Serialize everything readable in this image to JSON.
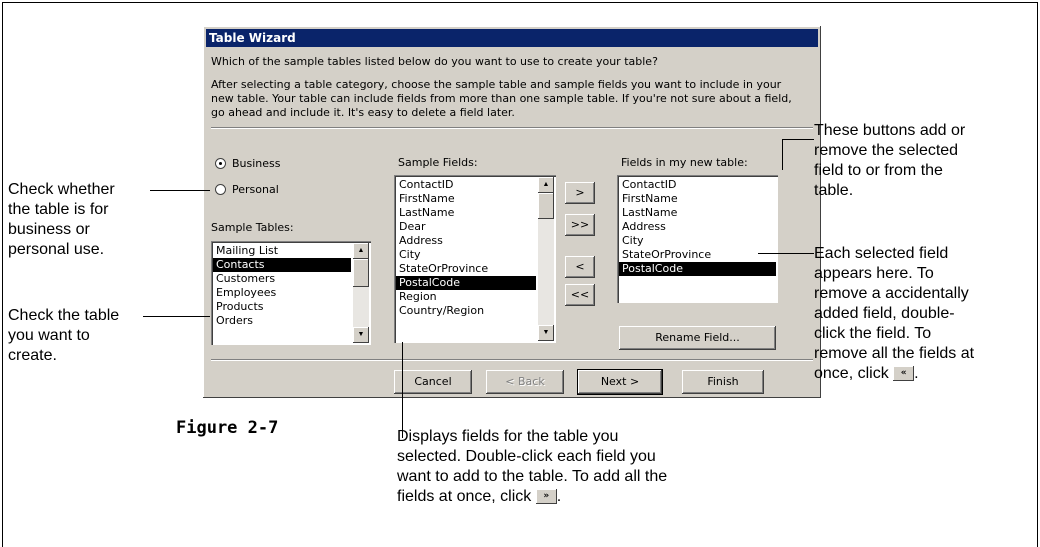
{
  "dialog": {
    "title": "Table Wizard",
    "question": "Which of the sample tables listed below do you want to use to create your table?",
    "description": "After selecting a table category, choose the sample table and sample fields you want to include in your new table. Your table can include fields from more than one sample table. If you're not sure about a field, go ahead and include it. It's easy to delete a field later.",
    "category": {
      "business_label": "Business",
      "personal_label": "Personal",
      "selected": "Business"
    },
    "sample_tables": {
      "label": "Sample Tables:",
      "items": [
        "Mailing List",
        "Contacts",
        "Customers",
        "Employees",
        "Products",
        "Orders"
      ],
      "selected": "Contacts"
    },
    "sample_fields": {
      "label": "Sample Fields:",
      "items": [
        "ContactID",
        "FirstName",
        "LastName",
        "Dear",
        "Address",
        "City",
        "StateOrProvince",
        "PostalCode",
        "Region",
        "Country/Region"
      ],
      "selected": "PostalCode"
    },
    "new_fields": {
      "label": "Fields in my new table:",
      "items": [
        "ContactID",
        "FirstName",
        "LastName",
        "Address",
        "City",
        "StateOrProvince",
        "PostalCode"
      ],
      "selected": "PostalCode"
    },
    "buttons": {
      "add_one": ">",
      "add_all": ">>",
      "remove_one": "<",
      "remove_all": "<<",
      "rename": "Rename Field...",
      "cancel": "Cancel",
      "back": "< Back",
      "next": "Next >",
      "finish": "Finish"
    }
  },
  "annotations": {
    "category": [
      "Check whether",
      "the table is for",
      "business or",
      "personal use."
    ],
    "table": [
      "Check the table",
      "you want to",
      "create."
    ],
    "buttons": [
      "These buttons add or",
      "remove the selected",
      "field to or from the",
      "table."
    ],
    "selected_field": [
      "Each selected field",
      "appears here. To",
      "remove a accidentally",
      "added field, double-",
      "click the field. To",
      "remove all the fields at",
      "once, click"
    ],
    "sample_fields": [
      "Displays fields for the table you",
      "selected. Double-click each field you",
      "want to add to the table. To add all the",
      "fields at once, click"
    ],
    "remove_all_icon": "«",
    "add_all_icon": "»",
    "period": "."
  },
  "figure_label": "Figure 2-7"
}
